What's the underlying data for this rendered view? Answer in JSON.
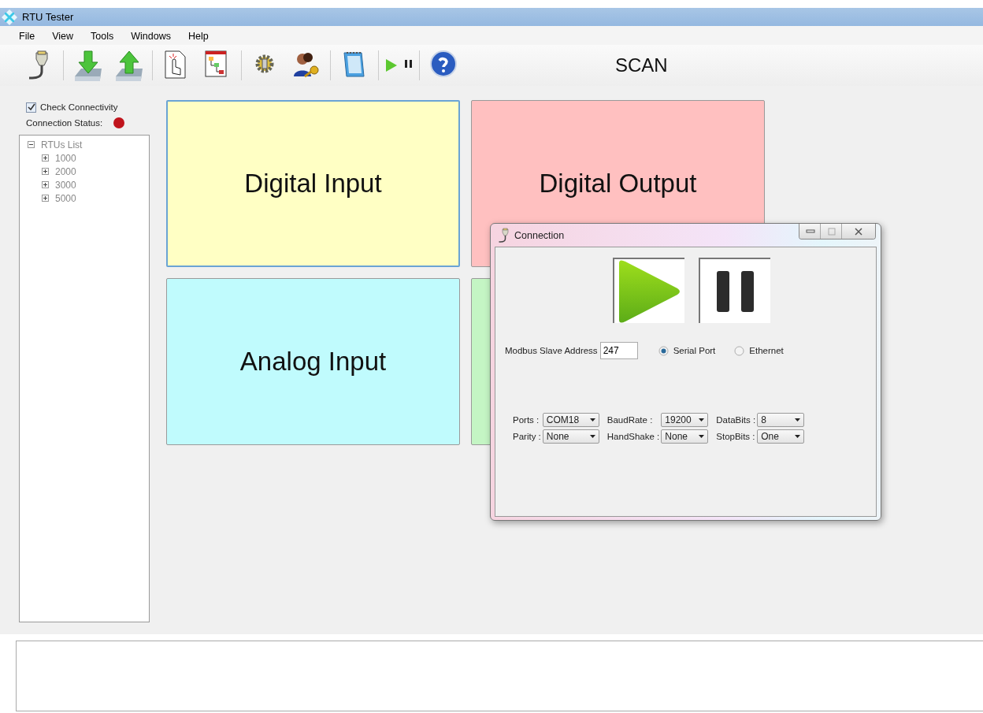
{
  "window": {
    "title": "RTU Tester"
  },
  "menu": [
    {
      "label": "File"
    },
    {
      "label": "View"
    },
    {
      "label": "Tools"
    },
    {
      "label": "Windows"
    },
    {
      "label": "Help"
    }
  ],
  "toolbar": {
    "status_text": "SCAN"
  },
  "sidebar": {
    "check_connectivity": {
      "label": "Check Connectivity",
      "checked": true
    },
    "connection_status": {
      "label": "Connection Status:",
      "color": "#c0141c"
    },
    "tree": [
      {
        "label": "RTUs List",
        "expanded": true,
        "children": [
          {
            "label": "1000",
            "expanded": false
          },
          {
            "label": "2000",
            "expanded": false
          },
          {
            "label": "3000",
            "expanded": false
          },
          {
            "label": "5000",
            "expanded": false
          }
        ]
      }
    ]
  },
  "tiles": [
    {
      "label": "Digital Input",
      "color": "#ffffc4",
      "selected": true
    },
    {
      "label": "Digital Output",
      "color": "#ffc0c0",
      "selected": false
    },
    {
      "label": "Analog Input",
      "color": "#c0fbfd",
      "selected": false
    },
    {
      "color": "#c4f5c4",
      "selected": false
    }
  ],
  "dialog": {
    "title": "Connection",
    "address_label": "Modbus Slave Address",
    "address": "247",
    "connection_types": [
      {
        "label": "Serial Port",
        "selected": true
      },
      {
        "label": "Ethernet",
        "selected": false
      }
    ],
    "settings": [
      {
        "label": "Ports :",
        "value": "COM18"
      },
      {
        "label": "BaudRate :",
        "value": "19200"
      },
      {
        "label": "DataBits :",
        "value": "8"
      },
      {
        "label": "Parity :",
        "value": "None"
      },
      {
        "label": "HandShake :",
        "value": "None"
      },
      {
        "label": "StopBits :",
        "value": "One"
      }
    ]
  }
}
